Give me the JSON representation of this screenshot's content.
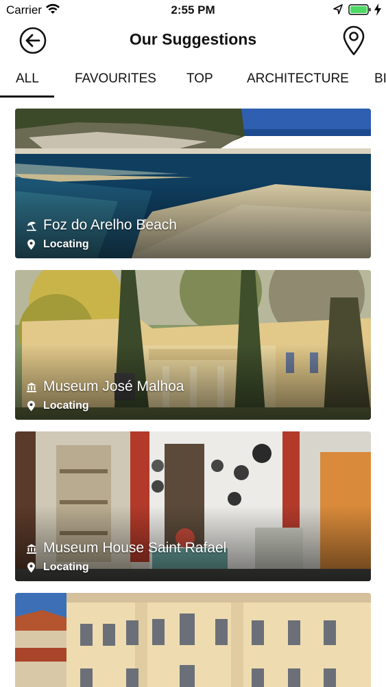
{
  "status_bar": {
    "carrier": "Carrier",
    "time": "2:55 PM",
    "wifi_icon": "wifi-icon",
    "location_icon": "location-arrow-icon",
    "battery_icon": "battery-icon",
    "charging_icon": "charging-bolt-icon",
    "battery_color": "#4cd964"
  },
  "header": {
    "title": "Our Suggestions",
    "back_icon": "back-arrow-icon",
    "map_icon": "map-pin-icon"
  },
  "tabs": [
    {
      "label": "ALL",
      "active": true
    },
    {
      "label": "FAVOURITES",
      "active": false
    },
    {
      "label": "TOP",
      "active": false
    },
    {
      "label": "ARCHITECTURE",
      "active": false
    },
    {
      "label": "BI",
      "active": false
    }
  ],
  "cards": [
    {
      "title": "Foz do Arelho Beach",
      "status": "Locating",
      "category_icon": "beach-umbrella-icon",
      "pin_icon": "location-pin-icon"
    },
    {
      "title": "Museum José Malhoa",
      "status": "Locating",
      "category_icon": "museum-icon",
      "pin_icon": "location-pin-icon"
    },
    {
      "title": "Museum House Saint Rafael",
      "status": "Locating",
      "category_icon": "museum-icon",
      "pin_icon": "location-pin-icon"
    },
    {
      "title": "",
      "status": "",
      "category_icon": "",
      "pin_icon": ""
    }
  ],
  "colors": {
    "accent": "#111111",
    "background": "#ffffff",
    "card_text": "#ffffff"
  }
}
